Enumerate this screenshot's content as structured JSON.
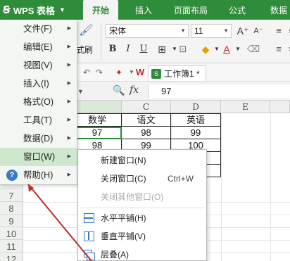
{
  "app": {
    "menu_button": "WPS 表格"
  },
  "ribbon_tabs": [
    "开始",
    "插入",
    "页面布局",
    "公式",
    "数据"
  ],
  "font": {
    "name": "宋体",
    "size": "11"
  },
  "ribbon_labels": {
    "format_painter": "式刷"
  },
  "document": {
    "title": "工作簿1 *"
  },
  "formula_bar": {
    "fx": "fx",
    "value": "97"
  },
  "columns": [
    "E",
    "C",
    "D",
    "E"
  ],
  "rows": [
    "",
    "",
    "",
    "",
    "",
    "",
    "7",
    "8",
    "9",
    "10",
    "11",
    "12"
  ],
  "table": {
    "header": [
      "数学",
      "语文",
      "英语"
    ],
    "rows": [
      [
        "97",
        "98",
        "99"
      ],
      [
        "98",
        "99",
        "100"
      ],
      [
        "",
        "",
        ""
      ],
      [
        "",
        "",
        ""
      ]
    ]
  },
  "app_menu": {
    "items": [
      {
        "label": "文件(F)",
        "arrow": "▶"
      },
      {
        "label": "编辑(E)",
        "arrow": "▶"
      },
      {
        "label": "视图(V)",
        "arrow": "▶"
      },
      {
        "label": "插入(I)",
        "arrow": "▶"
      },
      {
        "label": "格式(O)",
        "arrow": "▶"
      },
      {
        "label": "工具(T)",
        "arrow": "▶"
      },
      {
        "label": "数据(D)",
        "arrow": "▶"
      },
      {
        "label": "窗口(W)",
        "arrow": "▶"
      },
      {
        "label": "帮助(H)",
        "arrow": "▶"
      }
    ]
  },
  "window_menu": {
    "items": [
      {
        "label": "新建窗口(N)",
        "shortcut": ""
      },
      {
        "label": "关闭窗口(C)",
        "shortcut": "Ctrl+W"
      },
      {
        "label": "关闭其他窗口(O)",
        "shortcut": ""
      },
      {
        "label": "水平平铺(H)",
        "shortcut": ""
      },
      {
        "label": "垂直平铺(V)",
        "shortcut": ""
      },
      {
        "label": "层叠(A)",
        "shortcut": ""
      }
    ]
  },
  "colors": {
    "brand": "#2f8c3a",
    "annotation": "#c0282a"
  }
}
